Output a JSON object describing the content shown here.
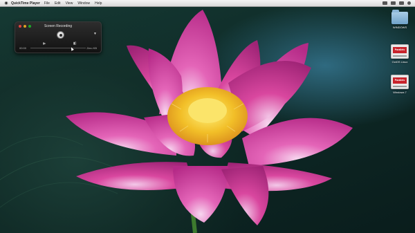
{
  "menubar": {
    "apple": "",
    "app_name": "QuickTime Player",
    "items": [
      "File",
      "Edit",
      "View",
      "Window",
      "Help"
    ]
  },
  "recording_window": {
    "title": "Screen Recording",
    "time": "00:00",
    "size": "Zero KB",
    "volume_low_icon": "speaker-low-icon",
    "volume_high_icon": "speaker-high-icon"
  },
  "desktop_icons": [
    {
      "label": "WINDOWS",
      "icon": "folder-icon"
    },
    {
      "label": "OctOS Linux",
      "icon": "parallels-vm-icon",
      "badge": "Parallels"
    },
    {
      "label": "Windows 7",
      "icon": "parallels-vm-icon",
      "badge": "Parallels"
    }
  ],
  "colors": {
    "lotus_pink": "#d63fa0",
    "lotus_center": "#f4c327",
    "record_red": "#e0443e"
  }
}
